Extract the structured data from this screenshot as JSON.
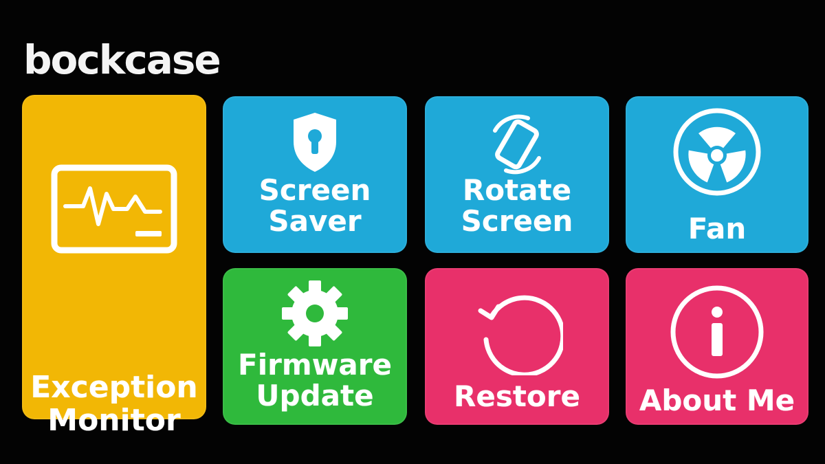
{
  "header": {
    "logo_text": "bockcase"
  },
  "colors": {
    "background": "#030303",
    "yellow": "#f2b705",
    "blue": "#1fa9d8",
    "green": "#2fb93c",
    "pink": "#e8306a",
    "text": "#ffffff"
  },
  "tiles": {
    "exception": {
      "line1": "Exception",
      "line2": "Monitor",
      "icon": "monitor-pulse-icon"
    },
    "saver": {
      "line1": "Screen",
      "line2": "Saver",
      "icon": "shield-keyhole-icon"
    },
    "rotate": {
      "line1": "Rotate",
      "line2": "Screen",
      "icon": "rotate-device-icon"
    },
    "fan": {
      "line1": "Fan",
      "icon": "fan-icon"
    },
    "firmware": {
      "line1": "Firmware",
      "line2": "Update",
      "icon": "gear-icon"
    },
    "restore": {
      "line1": "Restore",
      "icon": "restore-icon"
    },
    "about": {
      "line1": "About Me",
      "icon": "info-icon"
    }
  }
}
